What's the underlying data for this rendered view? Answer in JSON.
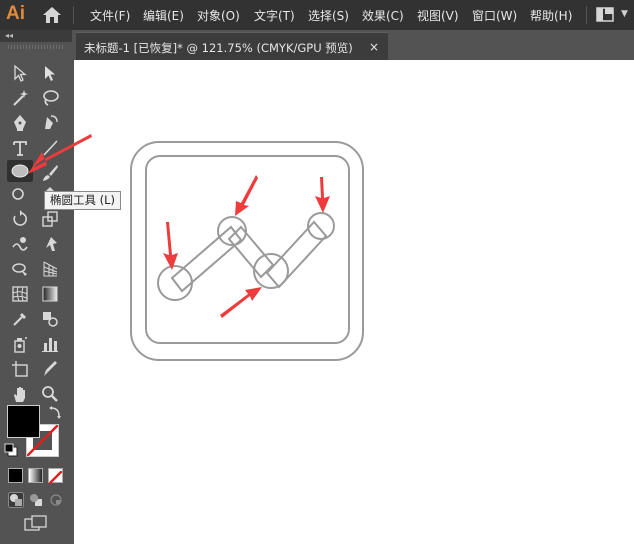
{
  "app": {
    "logo": "Ai"
  },
  "menu": {
    "items": [
      "文件(F)",
      "编辑(E)",
      "对象(O)",
      "文字(T)",
      "选择(S)",
      "效果(C)",
      "视图(V)",
      "窗口(W)",
      "帮助(H)"
    ]
  },
  "toolbar": {
    "collapse_label": "◂◂",
    "tools": [
      "selection-tool",
      "direct-selection-tool",
      "magic-wand-tool",
      "lasso-tool",
      "pen-tool",
      "curvature-tool",
      "type-tool",
      "line-segment-tool",
      "ellipse-tool",
      "paintbrush-tool",
      "shaper-tool",
      "eraser-tool",
      "rotate-tool",
      "scale-tool",
      "warp-tool",
      "free-transform-tool",
      "shape-builder-tool",
      "perspective-grid-tool",
      "mesh-tool",
      "gradient-tool",
      "eyedropper-tool",
      "blend-tool",
      "symbol-sprayer-tool",
      "column-graph-tool",
      "artboard-tool",
      "slice-tool",
      "hand-tool",
      "zoom-tool"
    ],
    "active_tool": "ellipse-tool",
    "fill_color": "#000000",
    "stroke_color": "none"
  },
  "document": {
    "tab_title": "未标题-1 [已恢复]* @ 121.75% (CMYK/GPU 预览)",
    "close_glyph": "×"
  },
  "tooltip": {
    "text": "椭圆工具 (L)"
  },
  "colors": {
    "menubar_bg": "#323232",
    "panel_bg": "#535353",
    "logo": "#e28a3a",
    "artwork_stroke": "#9a9a9a",
    "annotation_arrow": "#ee3b3b"
  }
}
